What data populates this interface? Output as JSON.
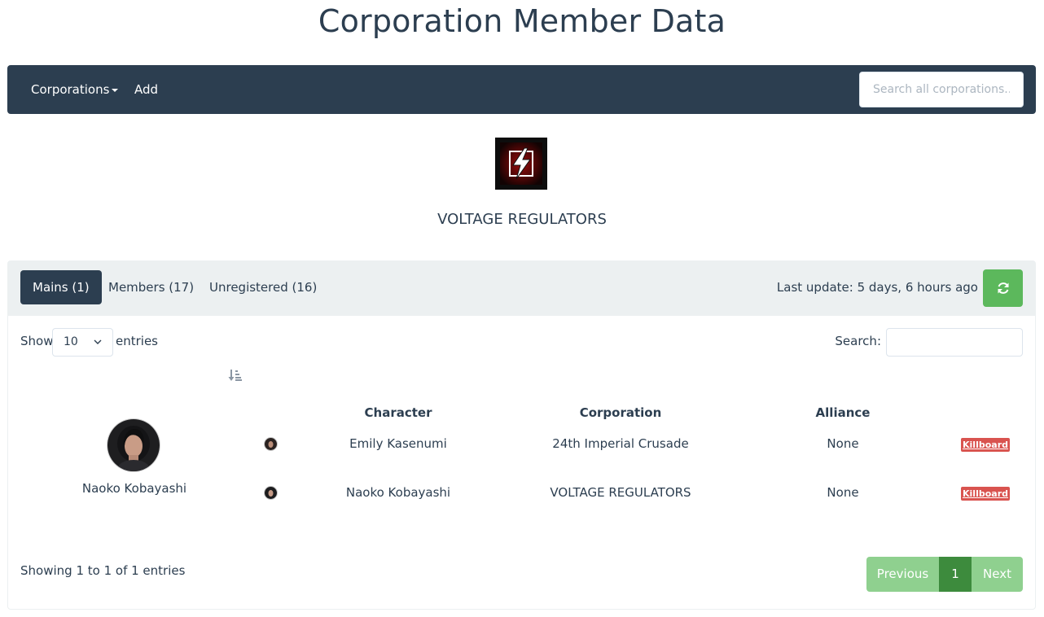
{
  "page_title": "Corporation Member Data",
  "navbar": {
    "corporations_label": "Corporations",
    "add_label": "Add",
    "search_placeholder": "Search all corporations..."
  },
  "corporation": {
    "name": "VOLTAGE REGULATORS",
    "logo_icon": "lightning-bolt-icon"
  },
  "tabs": [
    {
      "label": "Mains (1)",
      "active": true
    },
    {
      "label": "Members (17)",
      "active": false
    },
    {
      "label": "Unregistered (16)",
      "active": false
    }
  ],
  "last_update": "Last update: 5 days, 6 hours ago",
  "refresh_icon": "refresh-icon",
  "table_controls": {
    "show_label": "Show",
    "length_value": "10",
    "entries_label": "entries",
    "search_label": "Search:"
  },
  "main_character": {
    "name": "Naoko Kobayashi"
  },
  "columns": [
    "Character",
    "Corporation",
    "Alliance"
  ],
  "rows": [
    {
      "character": "Emily Kasenumi",
      "corporation": "24th Imperial Crusade",
      "alliance": "None",
      "killboard": "Killboard"
    },
    {
      "character": "Naoko Kobayashi",
      "corporation": "VOLTAGE REGULATORS",
      "alliance": "None",
      "killboard": "Killboard"
    }
  ],
  "footer": {
    "showing": "Showing 1 to 1 of 1 entries",
    "previous": "Previous",
    "page": "1",
    "next": "Next"
  },
  "colors": {
    "primary": "#2c3e50",
    "success": "#5cb85c",
    "danger": "#d9534f",
    "panel_head": "#ecf0f1"
  }
}
